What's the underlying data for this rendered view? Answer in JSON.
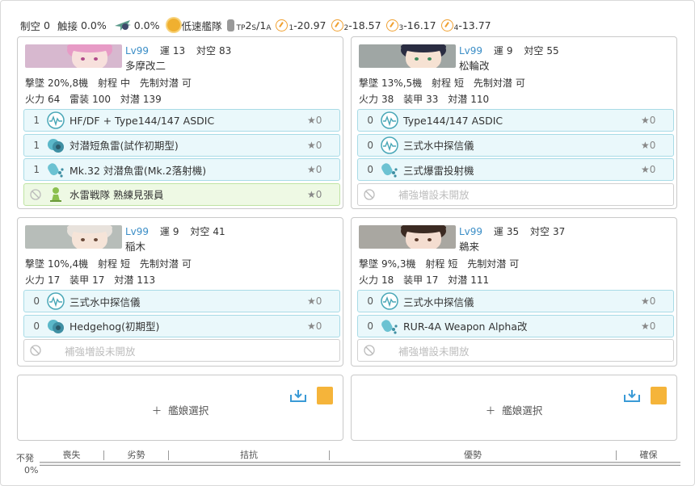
{
  "summary": {
    "air_control_label": "制空",
    "air_control_value": "0",
    "contact_label": "触接",
    "contact_value": "0.0%",
    "plane_value": "0.0%",
    "speed": "低速艦隊",
    "tp_value": "2",
    "tp_sub": "TP",
    "tp_sub2": "S",
    "tp_sep": " / ",
    "tp_a_value": "1",
    "tp_a_sub": "A",
    "gauges": [
      {
        "sub": "1",
        "value": "-20.97"
      },
      {
        "sub": "2",
        "value": "-18.57"
      },
      {
        "sub": "3",
        "value": "-16.17"
      },
      {
        "sub": "4",
        "value": "-13.77"
      }
    ]
  },
  "labels": {
    "luck": "運",
    "aa": "対空",
    "asw_label": "撃墜",
    "range_label": "射程",
    "oasw_label": "先制対潜",
    "firepower": "火力",
    "torpedo": "雷装",
    "armor": "装甲",
    "asw": "対潜",
    "empty_slot": "補強増設未開放",
    "select_ship": "艦娘選択"
  },
  "ships": [
    {
      "level": "Lv99",
      "luck": "13",
      "aa": "83",
      "name": "多摩改二",
      "shoot": "20%,8機",
      "range": "中",
      "oasw": "可",
      "stat2_label": "雷装",
      "fp": "64",
      "stat2": "100",
      "asw": "139",
      "slots": [
        {
          "count": "1",
          "name": "HF/DF + Type144/147 ASDIC",
          "star": "0",
          "icon": "sonar-icon",
          "type": "blue"
        },
        {
          "count": "1",
          "name": "対潜短魚雷(試作初期型)",
          "star": "0",
          "icon": "depth-charge-icon",
          "type": "blue"
        },
        {
          "count": "1",
          "name": "Mk.32 対潜魚雷(Mk.2落射機)",
          "star": "0",
          "icon": "depth-charge-projector-icon",
          "type": "blue"
        },
        {
          "count": "",
          "name": "水雷戦隊 熟練見張員",
          "star": "0",
          "icon": "lookout-icon",
          "type": "green"
        }
      ]
    },
    {
      "level": "Lv99",
      "luck": "9",
      "aa": "55",
      "name": "松輪改",
      "shoot": "13%,5機",
      "range": "短",
      "oasw": "可",
      "stat2_label": "装甲",
      "fp": "38",
      "stat2": "33",
      "asw": "110",
      "slots": [
        {
          "count": "0",
          "name": "Type144/147 ASDIC",
          "star": "0",
          "icon": "sonar-icon",
          "type": "blue"
        },
        {
          "count": "0",
          "name": "三式水中探信儀",
          "star": "0",
          "icon": "sonar-icon",
          "type": "blue"
        },
        {
          "count": "0",
          "name": "三式爆雷投射機",
          "star": "0",
          "icon": "depth-charge-projector-icon",
          "type": "blue"
        },
        {
          "count": "",
          "name": "補強増設未開放",
          "star": "",
          "icon": "",
          "type": "closed"
        }
      ]
    },
    {
      "level": "Lv99",
      "luck": "9",
      "aa": "41",
      "name": "稲木",
      "shoot": "10%,4機",
      "range": "短",
      "oasw": "可",
      "stat2_label": "装甲",
      "fp": "17",
      "stat2": "17",
      "asw": "113",
      "slots": [
        {
          "count": "0",
          "name": "三式水中探信儀",
          "star": "0",
          "icon": "sonar-icon",
          "type": "blue"
        },
        {
          "count": "0",
          "name": "Hedgehog(初期型)",
          "star": "0",
          "icon": "depth-charge-icon",
          "type": "blue"
        },
        {
          "count": "",
          "name": "補強増設未開放",
          "star": "",
          "icon": "",
          "type": "closed"
        }
      ]
    },
    {
      "level": "Lv99",
      "luck": "35",
      "aa": "37",
      "name": "鵜来",
      "shoot": "9%,3機",
      "range": "短",
      "oasw": "可",
      "stat2_label": "装甲",
      "fp": "18",
      "stat2": "17",
      "asw": "111",
      "slots": [
        {
          "count": "0",
          "name": "三式水中探信儀",
          "star": "0",
          "icon": "sonar-icon",
          "type": "blue"
        },
        {
          "count": "0",
          "name": "RUR-4A Weapon Alpha改",
          "star": "",
          "icon": "depth-charge-projector-icon",
          "type": "blue"
        },
        {
          "count": "",
          "name": "補強増設未開放",
          "star": "",
          "icon": "",
          "type": "closed"
        }
      ]
    }
  ],
  "gauge": {
    "no_fire": "不発",
    "no_fire_value": "0%",
    "segments": [
      "喪失",
      "劣勢",
      "拮抗",
      "優勢",
      "確保"
    ]
  },
  "colors": {
    "accent": "#3a8dc6",
    "slot_blue": "#eaf8fb",
    "slot_green": "#eef9e4",
    "clipboard": "#f5b43a"
  }
}
